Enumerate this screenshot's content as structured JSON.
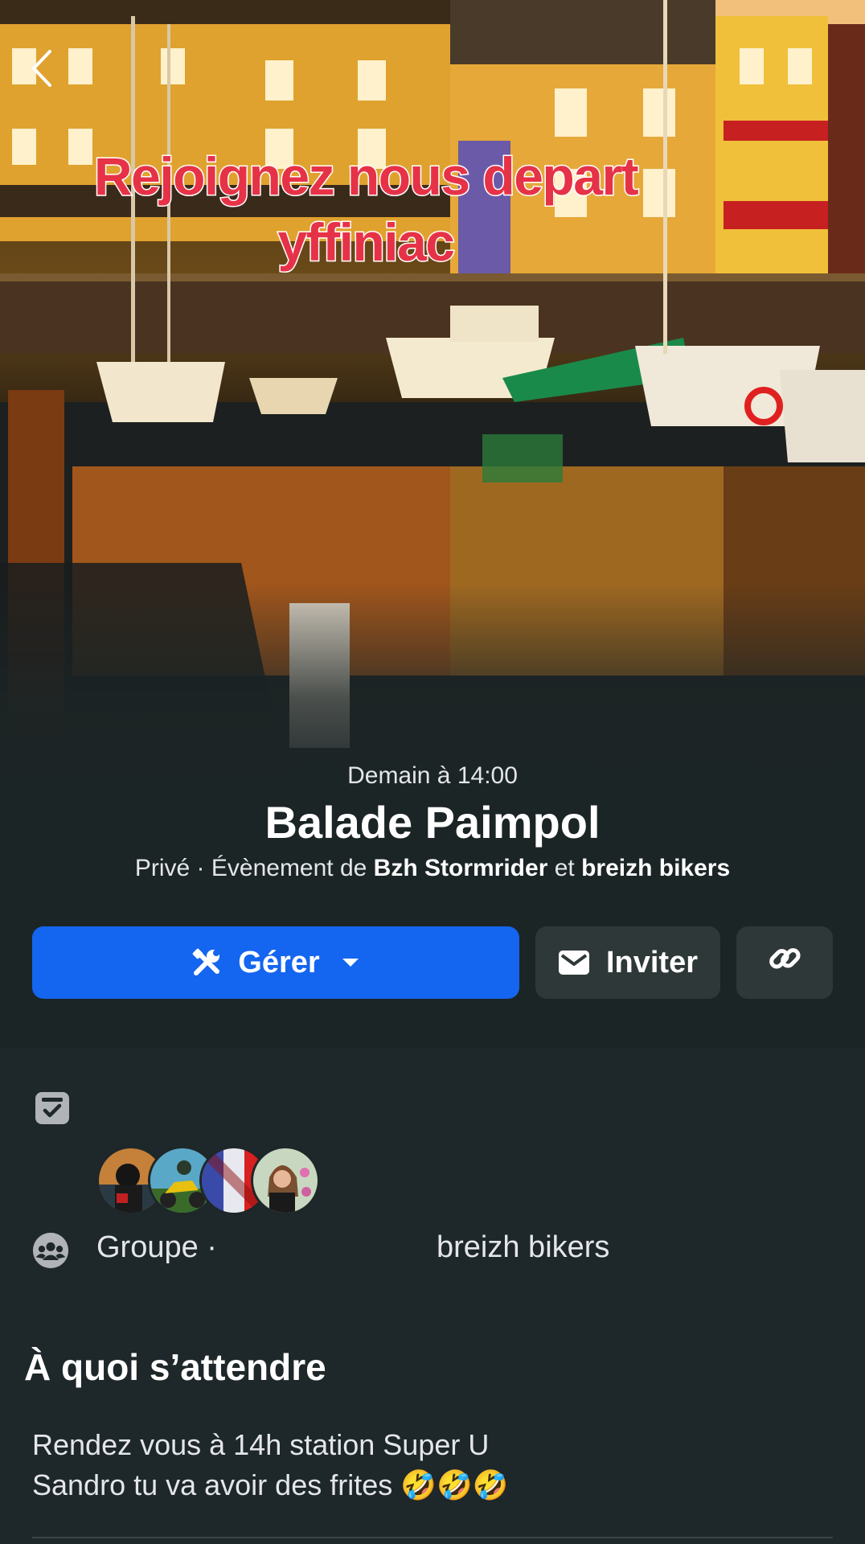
{
  "cover": {
    "overlay_text_line1": "Rejoignez nous depart",
    "overlay_text_line2": "yffiniac"
  },
  "navigation": {
    "back_icon": "chevron-left-icon"
  },
  "event": {
    "date": "Demain à 14:00",
    "title": "Balade Paimpol",
    "privacy": "Privé",
    "separator": " · ",
    "by_prefix": "Évènement de ",
    "host1": "Bzh Stormrider",
    "and": " et ",
    "host2": "breizh bikers"
  },
  "actions": {
    "manage_label": "Gérer",
    "manage_icon": "tools-icon",
    "manage_dropdown_icon": "caret-down-icon",
    "invite_label": "Inviter",
    "invite_icon": "envelope-icon",
    "link_icon": "link-icon"
  },
  "details": {
    "checklist_icon": "calendar-check-icon",
    "group_icon": "group-icon",
    "group_label": "Groupe ·",
    "group_name": "breizh bikers"
  },
  "about": {
    "title": "À quoi s’attendre",
    "line1": "Rendez vous à 14h station Super U",
    "line2": "Sandro tu va avoir des frites 🤣🤣🤣"
  },
  "colors": {
    "primary_button": "#1465f0",
    "secondary_button": "#2f3839",
    "background": "#1c2526",
    "overlay_text": "#e63247"
  }
}
